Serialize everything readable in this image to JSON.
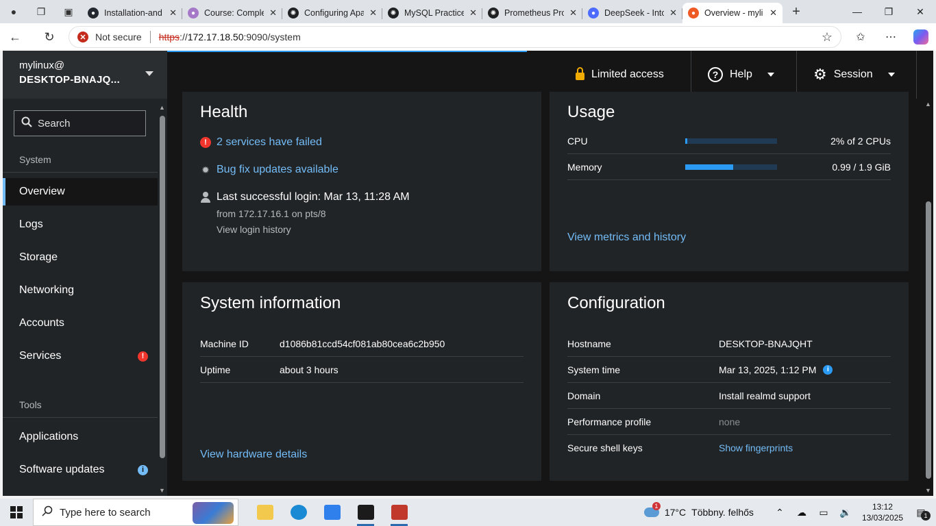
{
  "browser": {
    "tabs": [
      {
        "title": "Installation-and",
        "icon": "github-icon",
        "color": "#24292f"
      },
      {
        "title": "Course: Comple",
        "icon": "course-icon",
        "color": "#a678c8"
      },
      {
        "title": "Configuring Apa",
        "icon": "chatgpt-icon",
        "color": "#202123"
      },
      {
        "title": "MySQL Practice",
        "icon": "chatgpt-icon",
        "color": "#202123"
      },
      {
        "title": "Prometheus Pro",
        "icon": "chatgpt-icon",
        "color": "#202123"
      },
      {
        "title": "DeepSeek - Into",
        "icon": "deepseek-icon",
        "color": "#4d6bfe"
      },
      {
        "title": "Overview - myli",
        "icon": "cockpit-icon",
        "color": "#ee5a24"
      }
    ],
    "security_label": "Not secure",
    "url_scheme": "https",
    "url_sep": "://",
    "url_host": "172.17.18.50",
    "url_rest": ":9090/system"
  },
  "cockpit": {
    "host_user": "mylinux@",
    "host_name": "DESKTOP-BNAJQ...",
    "search_label": "Search",
    "system_heading": "System",
    "tools_heading": "Tools",
    "nav_items": [
      "Overview",
      "Logs",
      "Storage",
      "Networking",
      "Accounts",
      "Services"
    ],
    "tool_items": [
      "Applications",
      "Software updates"
    ],
    "badges": {
      "services": "!",
      "updates": "i"
    },
    "topbar": {
      "limited_access": "Limited access",
      "help": "Help",
      "session": "Session"
    },
    "health": {
      "title": "Health",
      "failed": "2 services have failed",
      "updates": "Bug fix updates available",
      "login": "Last successful login: Mar 13, 11:28 AM",
      "login_from": "from 172.17.16.1 on pts/8",
      "login_history": "View login history"
    },
    "usage": {
      "title": "Usage",
      "cpu_label": "CPU",
      "cpu_value": "2% of 2 CPUs",
      "cpu_fraction": 0.02,
      "memory_label": "Memory",
      "memory_value": "0.99 / 1.9 GiB",
      "memory_fraction": 0.52,
      "metrics_link": "View metrics and history"
    },
    "sysinfo": {
      "title": "System information",
      "machine_id_label": "Machine ID",
      "machine_id": "d1086b81ccd54cf081ab80cea6c2b950",
      "uptime_label": "Uptime",
      "uptime": "about 3 hours",
      "hardware_link": "View hardware details"
    },
    "config": {
      "title": "Configuration",
      "hostname_label": "Hostname",
      "hostname": "DESKTOP-BNAJQHT",
      "time_label": "System time",
      "time": "Mar 13, 2025, 1:12 PM",
      "domain_label": "Domain",
      "domain": "Install realmd support",
      "perf_label": "Performance profile",
      "perf": "none",
      "ssh_label": "Secure shell keys",
      "ssh": "Show fingerprints"
    }
  },
  "taskbar": {
    "search_placeholder": "Type here to search",
    "weather_temp": "17°C",
    "weather_desc": "Többny. felhős",
    "weather_badge": "1",
    "time": "13:12",
    "date": "13/03/2025",
    "notif_count": "1"
  }
}
